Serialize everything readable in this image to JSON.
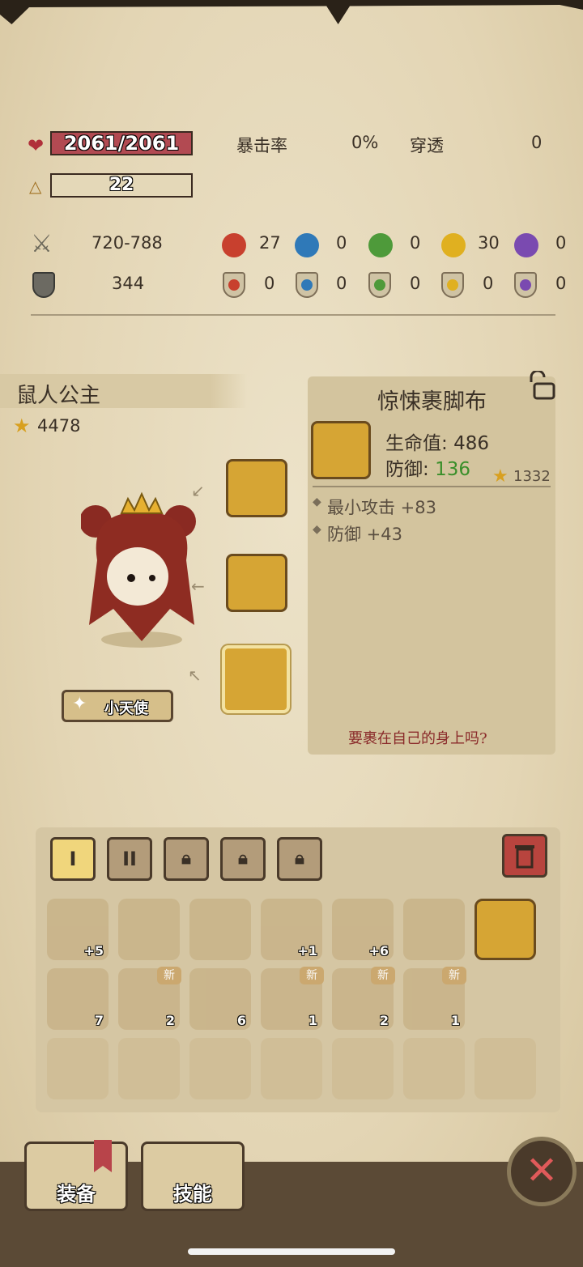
{
  "stats": {
    "hp": "2061/2061",
    "level": "22",
    "crit_label": "暴击率",
    "crit_value": "0%",
    "pierce_label": "穿透",
    "pierce_value": "0",
    "attack": "720-788",
    "defense": "344",
    "attack_elements": [
      "27",
      "0",
      "0",
      "30",
      "0"
    ],
    "defense_elements": [
      "0",
      "0",
      "0",
      "0",
      "0"
    ]
  },
  "character": {
    "name": "鼠人公主",
    "star_score": "4478",
    "pet_label": "小天使"
  },
  "item_card": {
    "title": "惊悚裹脚布",
    "hp_label": "生命值:",
    "hp_value": "486",
    "def_label": "防御:",
    "def_value": "136",
    "star_score": "1332",
    "bonus1": "最小攻击 +83",
    "bonus2": "防御 +43",
    "flavor": "要裹在自己的身上吗?"
  },
  "inventory": {
    "tabs": [
      "I",
      "II"
    ],
    "row1_counts": [
      "+5",
      "",
      "",
      "+1",
      "+6",
      "",
      ""
    ],
    "row2_counts": [
      "7",
      "2",
      "6",
      "1",
      "2",
      "1"
    ],
    "new_badge": "新"
  },
  "nav": {
    "equip": "装备",
    "skill": "技能"
  },
  "colors": {
    "hp_bar": "#b24a52",
    "defense_green": "#3a8f2a",
    "flavor_red": "#8a2a2a"
  }
}
